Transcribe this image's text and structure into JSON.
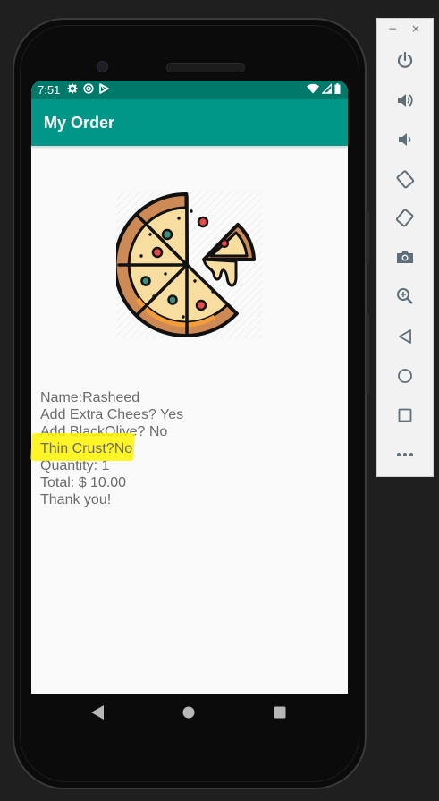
{
  "status_bar": {
    "time": "7:51"
  },
  "app_bar": {
    "title": "My Order"
  },
  "order": {
    "name": "Name:Rasheed",
    "extra_cheese": "Add Extra Chees? Yes",
    "black_olive": "Add BlackOlive? No",
    "thin_crust": "Thin Crust?No",
    "quantity": "Quantity: 1",
    "total": "Total: $ 10.00",
    "thanks": "Thank you!"
  },
  "colors": {
    "status_bar": "#00796b",
    "app_bar": "#009688",
    "highlight": "#fff200",
    "text": "#6b6b6b"
  },
  "emulator_controls": {
    "minimize": "−",
    "close": "×",
    "buttons": [
      "power-icon",
      "volume-up-icon",
      "volume-down-icon",
      "rotate-left-icon",
      "rotate-right-icon",
      "camera-icon",
      "zoom-icon",
      "back-icon",
      "home-icon",
      "overview-icon",
      "more-icon"
    ]
  },
  "nav_bar": {
    "buttons": [
      "back-triangle-icon",
      "home-circle-icon",
      "recents-square-icon"
    ]
  }
}
